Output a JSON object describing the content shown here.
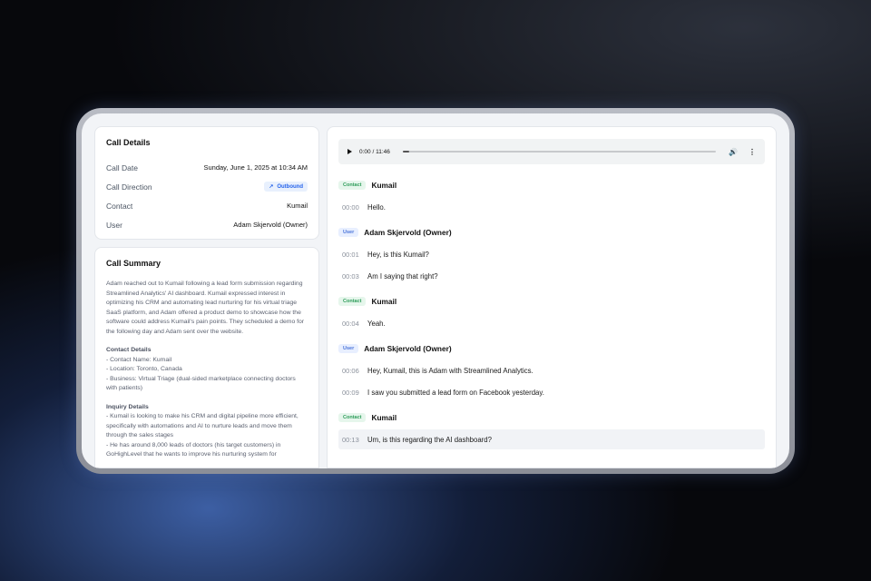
{
  "call_details": {
    "title": "Call Details",
    "rows": [
      {
        "label": "Call Date",
        "value": "Sunday, June 1, 2025 at 10:34 AM"
      },
      {
        "label": "Call Direction",
        "value": "Outbound"
      },
      {
        "label": "Contact",
        "value": "Kumail"
      },
      {
        "label": "User",
        "value": "Adam Skjervold (Owner)"
      }
    ]
  },
  "call_summary": {
    "title": "Call Summary",
    "paragraph": "Adam reached out to Kumail following a lead form submission regarding Streamlined Analytics' AI dashboard. Kumail expressed interest in optimizing his CRM and automating lead nurturing for his virtual triage SaaS platform, and Adam offered a product demo to showcase how the software could address Kumail's pain points. They scheduled a demo for the following day and Adam sent over the website.",
    "contact_heading": "Contact Details",
    "contact_lines": [
      "- Contact Name: Kumail",
      "- Location: Toronto, Canada",
      "- Business: Virtual Triage (dual-sided marketplace connecting doctors with patients)"
    ],
    "inquiry_heading": "Inquiry Details",
    "inquiry_lines": [
      "- Kumail is looking to make his CRM and digital pipeline more efficient, specifically with automations and AI to nurture leads and move them through the sales stages",
      "- He has around 8,000 leads of doctors (his target customers) in GoHighLevel that he wants to improve his nurturing system for"
    ]
  },
  "player": {
    "time": "0:00 / 11:46",
    "progress": 0.0
  },
  "transcript": [
    {
      "role": "Contact",
      "speaker": "Kumail",
      "lines": [
        {
          "ts": "00:00",
          "text": "Hello."
        }
      ]
    },
    {
      "role": "User",
      "speaker": "Adam Skjervold (Owner)",
      "lines": [
        {
          "ts": "00:01",
          "text": "Hey, is this Kumail?"
        },
        {
          "ts": "00:03",
          "text": "Am I saying that right?"
        }
      ]
    },
    {
      "role": "Contact",
      "speaker": "Kumail",
      "lines": [
        {
          "ts": "00:04",
          "text": "Yeah."
        }
      ]
    },
    {
      "role": "User",
      "speaker": "Adam Skjervold (Owner)",
      "lines": [
        {
          "ts": "00:06",
          "text": "Hey, Kumail, this is Adam with Streamlined Analytics."
        },
        {
          "ts": "00:09",
          "text": "I saw you submitted a lead form on Facebook yesterday."
        }
      ]
    },
    {
      "role": "Contact",
      "speaker": "Kumail",
      "lines": [
        {
          "ts": "00:13",
          "text": "Um, is this regarding the AI dashboard?"
        }
      ]
    }
  ],
  "colors": {
    "contact_tag": "#2e9d5a",
    "user_tag": "#4a74d9",
    "outbound_badge": "#2563eb"
  }
}
